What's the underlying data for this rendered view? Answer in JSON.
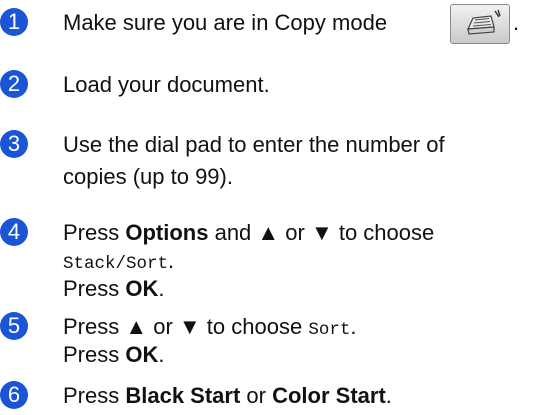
{
  "badge_color": "#1a55d6",
  "steps": [
    {
      "number": "1",
      "text": "Make sure you are in Copy mode",
      "trailing": ".",
      "icon": "copy-mode-icon"
    },
    {
      "number": "2",
      "text": "Load your document."
    },
    {
      "number": "3",
      "line1": "Use the dial pad to enter the number of",
      "line2": "copies (up to 99)."
    },
    {
      "number": "4",
      "press": "Press ",
      "options": "Options",
      "and": " and ▲ or ▼ to choose",
      "menu": "Stack/Sort",
      "menu_end": ".",
      "press2": "Press ",
      "ok": "OK",
      "end": "."
    },
    {
      "number": "5",
      "press": "Press ▲ or ▼ to choose ",
      "menu": "Sort",
      "menu_end": ".",
      "press2": "Press ",
      "ok": "OK",
      "end": "."
    },
    {
      "number": "6",
      "press": "Press ",
      "black": "Black Start",
      "or": " or ",
      "color": "Color Start",
      "end": "."
    }
  ]
}
